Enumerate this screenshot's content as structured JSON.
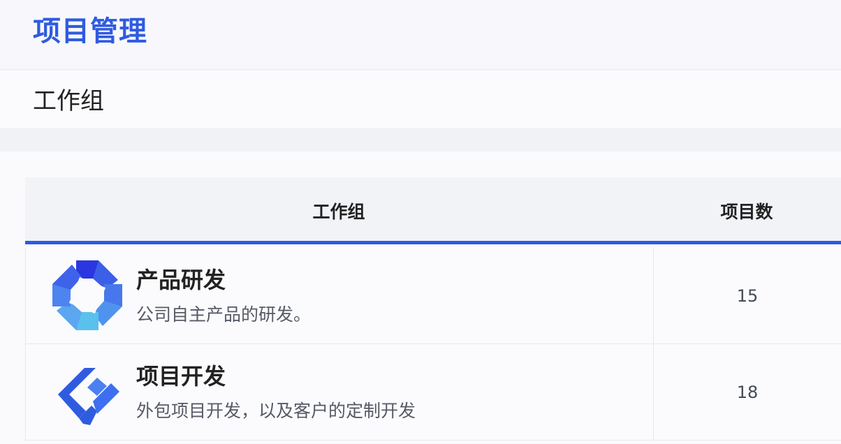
{
  "header": {
    "title": "项目管理"
  },
  "section": {
    "label": "工作组"
  },
  "table": {
    "columns": [
      "工作组",
      "项目数"
    ],
    "rows": [
      {
        "name": "产品研发",
        "description": "公司自主产品的研发。",
        "count": "15",
        "icon": "octagon-ring-icon"
      },
      {
        "name": "项目开发",
        "description": "外包项目开发，以及客户的定制开发",
        "count": "18",
        "icon": "check-shield-icon"
      }
    ]
  },
  "colors": {
    "accent": "#2f5be0",
    "header_bg": "#f2f3f7"
  }
}
